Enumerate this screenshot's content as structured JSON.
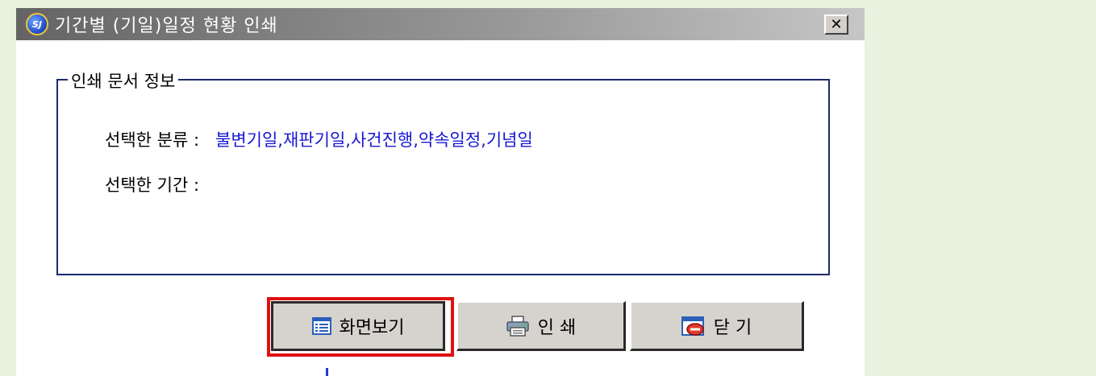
{
  "window": {
    "title": "기간별 (기일)일정 현황 인쇄",
    "app_icon_text": "SJ",
    "close_label": "✕"
  },
  "info_group": {
    "legend": "인쇄 문서 정보",
    "selected_category_label": "선택한 분류 :",
    "selected_category_value": "불변기일,재판기일,사건진행,약속일정,기념일",
    "selected_period_label": "선택한 기간 :",
    "selected_period_value": ""
  },
  "buttons": {
    "preview_label": "화면보기",
    "print_label": "인 쇄",
    "close_label": "닫 기"
  },
  "icons": {
    "preview": "list-view-icon",
    "print": "printer-icon",
    "close": "close-window-icon"
  },
  "colors": {
    "highlight": "#e01010",
    "value_text": "#1717d4",
    "group_border": "#1a2a6c",
    "page_background": "#e8f2df"
  }
}
